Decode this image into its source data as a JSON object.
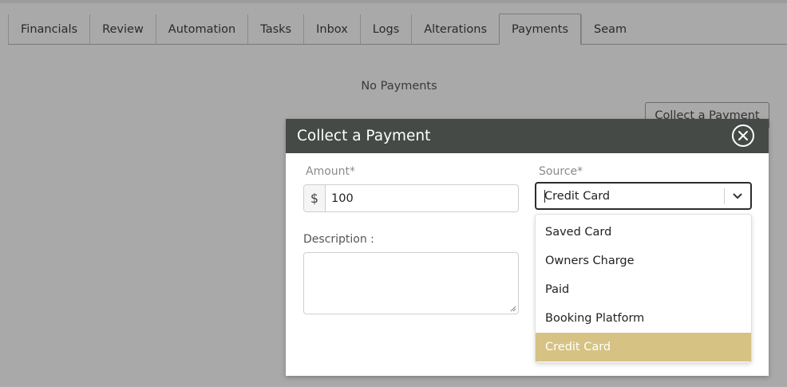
{
  "tabs": [
    {
      "label": "Financials",
      "active": false
    },
    {
      "label": "Review",
      "active": false
    },
    {
      "label": "Automation",
      "active": false
    },
    {
      "label": "Tasks",
      "active": false
    },
    {
      "label": "Inbox",
      "active": false
    },
    {
      "label": "Logs",
      "active": false
    },
    {
      "label": "Alterations",
      "active": false
    },
    {
      "label": "Payments",
      "active": true
    },
    {
      "label": "Seam",
      "active": false
    }
  ],
  "main": {
    "empty_text": "No Payments",
    "collect_button_label": "Collect a Payment"
  },
  "modal": {
    "title": "Collect a Payment",
    "close_icon": "close-circle-icon",
    "amount": {
      "label": "Amount*",
      "prefix": "$",
      "value": "100"
    },
    "description": {
      "label": "Description :",
      "value": ""
    },
    "source": {
      "label": "Source*",
      "selected": "Credit Card",
      "options": [
        "Saved Card",
        "Owners Charge",
        "Paid",
        "Booking Platform",
        "Credit Card"
      ],
      "selected_index": 4
    }
  },
  "colors": {
    "header_bg": "#464a47",
    "selected_option_bg": "#d6c283",
    "overlay": "#a9a9a9"
  }
}
